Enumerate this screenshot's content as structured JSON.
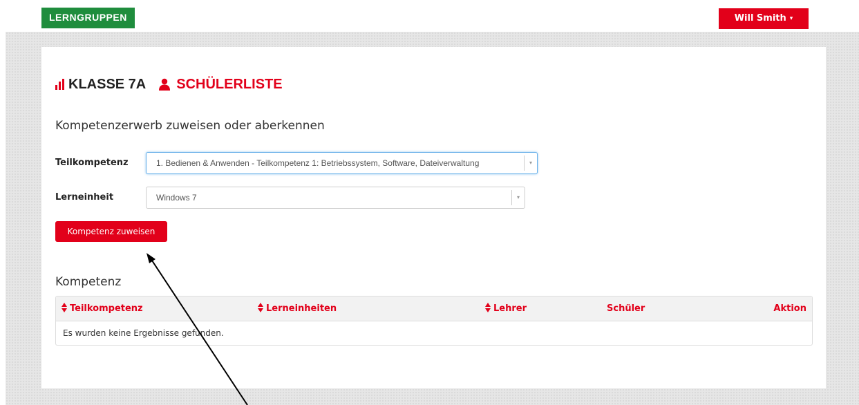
{
  "header": {
    "brand": "LERNGRUPPEN",
    "user": "Will Smith",
    "user_caret": "▾"
  },
  "page": {
    "class_title": "KLASSE 7A",
    "student_list_title": "SCHÜLERLISTE",
    "subtitle": "Kompetenzerwerb zuweisen oder aberkennen"
  },
  "form": {
    "teilkompetenz_label": "Teilkompetenz",
    "teilkompetenz_value": "1. Bedienen & Anwenden - Teilkompetenz 1: Betriebssystem, Software, Dateiverwaltung",
    "lerneinheit_label": "Lerneinheit",
    "lerneinheit_value": "Windows 7",
    "select_arrow": "▾",
    "assign_button": "Kompetenz zuweisen"
  },
  "table": {
    "title": "Kompetenz",
    "columns": [
      "Teilkompetenz",
      "Lerneinheiten",
      "Lehrer",
      "Schüler",
      "Aktion"
    ],
    "empty_message": "Es wurden keine Ergebnisse gefunden."
  },
  "colors": {
    "accent": "#e2001a",
    "brand": "#1f8d3d"
  }
}
